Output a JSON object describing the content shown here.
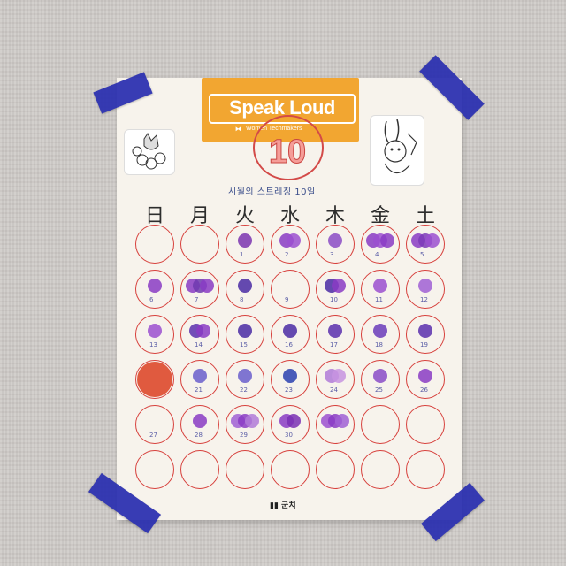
{
  "banner": {
    "title": "Speak Loud",
    "subtitle": "Women Techmakers"
  },
  "month": "10",
  "calendar_subtitle": "시월의 스트레칭 10일",
  "weekdays": [
    "日",
    "月",
    "火",
    "水",
    "木",
    "金",
    "土"
  ],
  "footer": "▮▮ 군치",
  "days": [
    {
      "num": "",
      "dots": []
    },
    {
      "num": "",
      "dots": []
    },
    {
      "num": "1",
      "dots": [
        {
          "color": "#7b34b0"
        }
      ]
    },
    {
      "num": "2",
      "dots": [
        {
          "color": "#8a3bc4"
        },
        {
          "color": "#9b4fd0"
        }
      ]
    },
    {
      "num": "3",
      "dots": [
        {
          "color": "#8b4bc5"
        }
      ]
    },
    {
      "num": "4",
      "dots": [
        {
          "color": "#8a3bc4"
        },
        {
          "color": "#9b4fd0"
        },
        {
          "color": "#8a3bc4"
        }
      ]
    },
    {
      "num": "5",
      "dots": [
        {
          "color": "#8a3bc4"
        },
        {
          "color": "#7d3ab8"
        },
        {
          "color": "#9b4fd0"
        }
      ]
    },
    {
      "num": "6",
      "dots": [
        {
          "color": "#8a3bc4"
        }
      ]
    },
    {
      "num": "7",
      "dots": [
        {
          "color": "#8a3bc4"
        },
        {
          "color": "#6e3aaf"
        },
        {
          "color": "#8a3bc4"
        }
      ]
    },
    {
      "num": "8",
      "dots": [
        {
          "color": "#4a2aa5"
        }
      ]
    },
    {
      "num": "9",
      "dots": []
    },
    {
      "num": "10",
      "dots": [
        {
          "color": "#4a2aa5"
        },
        {
          "color": "#8a3bc4"
        }
      ]
    },
    {
      "num": "11",
      "dots": [
        {
          "color": "#9b4fd0"
        }
      ]
    },
    {
      "num": "12",
      "dots": [
        {
          "color": "#a05fd5"
        }
      ]
    },
    {
      "num": "13",
      "dots": [
        {
          "color": "#9b4fd0"
        }
      ]
    },
    {
      "num": "14",
      "dots": [
        {
          "color": "#5b2fae"
        },
        {
          "color": "#8a3bc4"
        }
      ]
    },
    {
      "num": "15",
      "dots": [
        {
          "color": "#4a2aa5"
        }
      ]
    },
    {
      "num": "16",
      "dots": [
        {
          "color": "#4a2aa5"
        }
      ]
    },
    {
      "num": "17",
      "dots": [
        {
          "color": "#5b2fae"
        }
      ]
    },
    {
      "num": "18",
      "dots": [
        {
          "color": "#6a3bbb"
        }
      ]
    },
    {
      "num": "19",
      "dots": [
        {
          "color": "#5b2fae"
        }
      ]
    },
    {
      "num": "",
      "dots": [],
      "big_red": "#e05a3f"
    },
    {
      "num": "21",
      "dots": [
        {
          "color": "#6a5ecc"
        }
      ]
    },
    {
      "num": "22",
      "dots": [
        {
          "color": "#6a5ecc"
        }
      ]
    },
    {
      "num": "23",
      "dots": [
        {
          "color": "#2a3fb0"
        }
      ]
    },
    {
      "num": "24",
      "dots": [
        {
          "color": "#b07ad8"
        },
        {
          "color": "#c793e0"
        }
      ]
    },
    {
      "num": "25",
      "dots": [
        {
          "color": "#8a4bc8"
        }
      ]
    },
    {
      "num": "26",
      "dots": [
        {
          "color": "#8a3bc4"
        }
      ]
    },
    {
      "num": "27",
      "dots": []
    },
    {
      "num": "28",
      "dots": [
        {
          "color": "#8a3bc4"
        }
      ]
    },
    {
      "num": "29",
      "dots": [
        {
          "color": "#a05fd5"
        },
        {
          "color": "#8a3bc4"
        },
        {
          "color": "#b07ad8"
        }
      ]
    },
    {
      "num": "30",
      "dots": [
        {
          "color": "#8a3bc4"
        },
        {
          "color": "#7a30b4"
        }
      ]
    },
    {
      "num": "",
      "dots": [
        {
          "color": "#9b4fd0"
        },
        {
          "color": "#8a3bc4"
        },
        {
          "color": "#a05fd5"
        }
      ]
    },
    {
      "num": "",
      "dots": []
    },
    {
      "num": "",
      "dots": []
    },
    {
      "num": "",
      "dots": []
    },
    {
      "num": "",
      "dots": []
    },
    {
      "num": "",
      "dots": []
    },
    {
      "num": "",
      "dots": []
    },
    {
      "num": "",
      "dots": []
    },
    {
      "num": "",
      "dots": []
    },
    {
      "num": "",
      "dots": []
    }
  ]
}
